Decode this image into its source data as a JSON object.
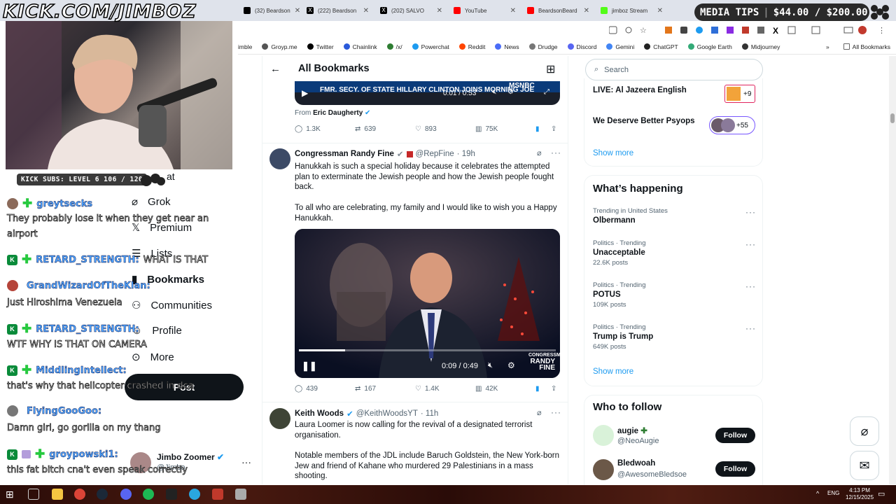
{
  "browser": {
    "tabs": [
      {
        "title": "(32) Beardson",
        "color": "#000000"
      },
      {
        "title": "(222) Beardson",
        "color": "#000000"
      },
      {
        "title": "(202) SALVO",
        "color": "#000000"
      },
      {
        "title": "YouTube",
        "color": "#ff0000"
      },
      {
        "title": "BeardsonBeard",
        "color": "#ff0000"
      },
      {
        "title": "jimboz Stream",
        "color": "#53fc18"
      }
    ],
    "bookmarks": [
      "imble",
      "Groyp.me",
      "Twitter",
      "Chainlink",
      "/x/",
      "Powerchat",
      "Reddit",
      "News",
      "Drudge",
      "Discord",
      "Gemini",
      "ChatGPT",
      "Google Earth",
      "Midjourney"
    ],
    "all_bookmarks": "All Bookmarks"
  },
  "overlay": {
    "kick_url": "KICK.COM/JIMBOZ",
    "media_tips_label": "MEDIA TIPS",
    "media_tips_value": "$44.00 / $200.00",
    "kick_subs": "KICK SUBS: LEVEL 6 106 / 120"
  },
  "chat": [
    {
      "user": "greytsecks",
      "msg": "They probably lose it when they get near an",
      "msg2": "airport",
      "badges": "plus"
    },
    {
      "user": "RETARD_STRENGTH:",
      "msg": "WHAT IS THAT",
      "badges": "k-plus"
    },
    {
      "user": "GrandWizardOfTheKlan:",
      "msg": "Just Hiroshima Venezuela",
      "badges": "orb"
    },
    {
      "user": "RETARD_STRENGTH:",
      "msg": "WTF WHY IS THAT ON CAMERA",
      "badges": "k-plus"
    },
    {
      "user": "MiddlingIntellect:",
      "msg": "that's why that helicopter crashed in dca",
      "badges": "k-plus"
    },
    {
      "user": "FlyingGooGoo:",
      "msg": "Damn girl, go gorilla on my thang",
      "badges": "avatar"
    },
    {
      "user": "groypowski1:",
      "msg": "this fat bitch cna't even speak correctly",
      "badges": "k-gift-plus"
    }
  ],
  "xnav": {
    "items": [
      "at",
      "Grok",
      "Premium",
      "Lists",
      "Bookmarks",
      "Communities",
      "Profile",
      "More"
    ],
    "post_button": "Post",
    "account_name": "Jimbo Zoomer",
    "account_handle": "@Jimbo"
  },
  "feed": {
    "header": "All Bookmarks",
    "tweet0": {
      "video_caption": "FMR. SECY. OF STATE HILLARY CLINTON JOINS MORNING JOE",
      "network": "MSNBC",
      "time": "0:01 / 0:53",
      "from_label": "From",
      "from_user": "Eric Daugherty",
      "replies": "1.3K",
      "reposts": "639",
      "likes": "893",
      "views": "75K"
    },
    "tweet1": {
      "name": "Congressman Randy Fine",
      "handle": "@RepFine",
      "age": "· 19h",
      "text1": "Hanukkah is such a special holiday because it celebrates the attempted plan to exterminate the Jewish people and how the Jewish people fought back.",
      "text2": "To all who are celebrating, my family and I would like to wish you a Happy Hanukkah.",
      "time": "0:09 / 0:49",
      "watermark1": "CONGRESSMAN",
      "watermark2": "RANDY",
      "watermark3": "FINE",
      "replies": "439",
      "reposts": "167",
      "likes": "1.4K",
      "views": "42K",
      "progress": 0.18
    },
    "tweet2": {
      "name": "Keith Woods",
      "handle": "@KeithWoodsYT",
      "age": "· 11h",
      "text1": "Laura Loomer is now calling for the revival of a designated terrorist organisation.",
      "text2": "Notable members of the JDL include Baruch Goldstein, the New York-born Jew and friend of Kahane who murdered 29 Palestinians in a mass shooting."
    }
  },
  "right": {
    "search_placeholder": "Search",
    "spaces": [
      {
        "title": "LIVE: Al Jazeera English",
        "count": "+9"
      },
      {
        "title": "We Deserve Better Psyops",
        "count": "+55"
      }
    ],
    "show_more": "Show more",
    "happening_title": "What’s happening",
    "trends": [
      {
        "cat": "Trending in United States",
        "name": "Olbermann",
        "count": ""
      },
      {
        "cat": "Politics · Trending",
        "name": "Unacceptable",
        "count": "22.6K posts"
      },
      {
        "cat": "Politics · Trending",
        "name": "POTUS",
        "count": "109K posts"
      },
      {
        "cat": "Politics · Trending",
        "name": "Trump is Trump",
        "count": "649K posts"
      }
    ],
    "who_title": "Who to follow",
    "follow": [
      {
        "name": "augie",
        "handle": "@NeoAugie",
        "button": "Follow"
      },
      {
        "name": "Bledwoah",
        "handle": "@AwesomeBledsoe",
        "button": "Follow"
      }
    ]
  },
  "taskbar": {
    "lang": "ENG",
    "time": "4:13 PM",
    "date": "12/15/2025"
  },
  "colors": {
    "x_blue": "#1d9bf0",
    "kick_green": "#53fc18",
    "text_primary": "#0f1419",
    "text_secondary": "#536471"
  }
}
